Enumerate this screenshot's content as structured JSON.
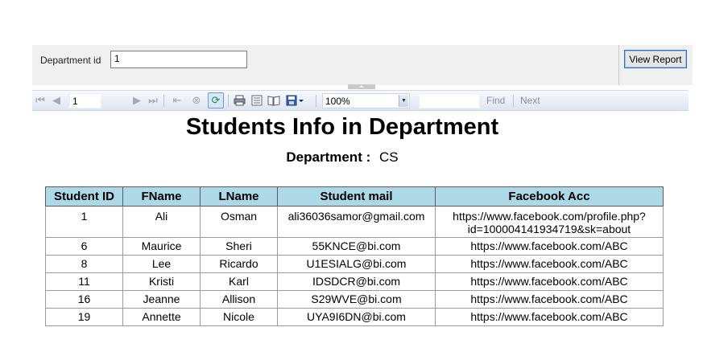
{
  "parameters": {
    "department_label": "Department id",
    "department_value": "1",
    "view_report_label": "View Report"
  },
  "toolbar": {
    "page_number": "1",
    "zoom": "100%",
    "find_label": "Find",
    "next_label": "Next",
    "icons": [
      "first-page-icon",
      "previous-page-icon",
      "next-page-icon",
      "last-page-icon",
      "back-icon",
      "stop-icon",
      "refresh-icon",
      "print-icon",
      "print-layout-icon",
      "page-setup-icon",
      "export-icon"
    ]
  },
  "report": {
    "title": "Students Info in Department",
    "department_label": "Department :",
    "department_value": "CS",
    "header_color": "#add8e6",
    "columns": [
      "Student ID",
      "FName",
      "LName",
      "Student mail",
      "Facebook Acc"
    ],
    "rows": [
      {
        "id": "1",
        "fname": "Ali",
        "lname": "Osman",
        "mail": "ali36036samor@gmail.com",
        "fb_line1": "https://www.facebook.com/profile.php?",
        "fb_line2": "id=100004141934719&sk=about"
      },
      {
        "id": "6",
        "fname": "Maurice",
        "lname": "Sheri",
        "mail": "55KNCE@bi.com",
        "fb": "https://www.facebook.com/ABC"
      },
      {
        "id": "8",
        "fname": "Lee",
        "lname": "Ricardo",
        "mail": "U1ESIALG@bi.com",
        "fb": "https://www.facebook.com/ABC"
      },
      {
        "id": "11",
        "fname": "Kristi",
        "lname": "Karl",
        "mail": "IDSDCR@bi.com",
        "fb": "https://www.facebook.com/ABC"
      },
      {
        "id": "16",
        "fname": "Jeanne",
        "lname": "Allison",
        "mail": "S29WVE@bi.com",
        "fb": "https://www.facebook.com/ABC"
      },
      {
        "id": "19",
        "fname": "Annette",
        "lname": "Nicole",
        "mail": "UYA9I6DN@bi.com",
        "fb": "https://www.facebook.com/ABC"
      }
    ]
  }
}
